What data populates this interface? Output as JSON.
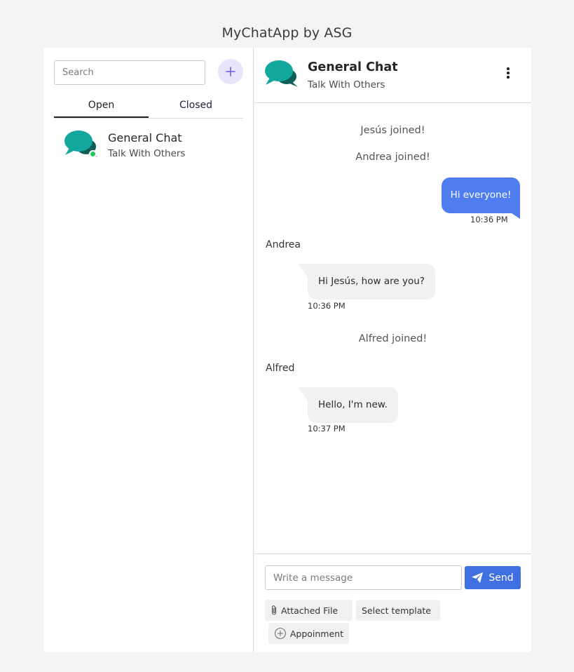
{
  "app_title": "MyChatApp by ASG",
  "sidebar": {
    "search_placeholder": "Search",
    "add_button_icon": "plus-icon",
    "tabs": [
      {
        "label": "Open",
        "active": true
      },
      {
        "label": "Closed",
        "active": false
      }
    ],
    "chats": [
      {
        "name": "General Chat",
        "description": "Talk With Others",
        "online": true,
        "icon": "chat-bubbles-icon"
      }
    ]
  },
  "chat": {
    "title": "General Chat",
    "subtitle": "Talk With Others",
    "menu_icon": "more-vertical-icon",
    "messages": {
      "system_1": "Jesús joined!",
      "system_2": "Andrea joined!",
      "me_1": {
        "text": "Hi everyone!",
        "time": "10:36 PM"
      },
      "andrea": {
        "sender": "Andrea",
        "text": "Hi Jesús, how are you?",
        "time": "10:36 PM"
      },
      "system_3": "Alfred joined!",
      "alfred": {
        "sender": "Alfred",
        "text": "Hello, I'm new.",
        "time": "10:37 PM"
      }
    },
    "composer": {
      "placeholder": "Write a message",
      "send_label": "Send",
      "attach_label": "Attached File",
      "template_label": "Select template",
      "appointment_label": "Appoinment"
    }
  },
  "colors": {
    "accent": "#4f7df0",
    "send_button": "#3f6fe0",
    "avatar_teal": "#13a89e",
    "avatar_dark": "#0e5f5a",
    "online": "#22c55e",
    "add_button_bg": "#e8e5fb",
    "add_button_fg": "#6b5be0"
  }
}
